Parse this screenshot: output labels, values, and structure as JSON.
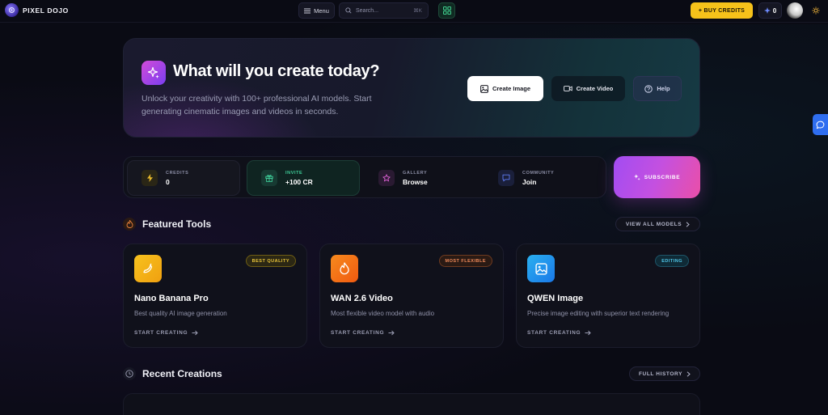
{
  "header": {
    "brand": "PIXEL DOJO",
    "menu_label": "Menu",
    "search_placeholder": "Search...",
    "search_shortcut": "⌘K",
    "buy_credits_label": "+ BUY CREDITS",
    "credit_count": "0"
  },
  "hero": {
    "title": "What will you create today?",
    "subtitle": "Unlock your creativity with 100+ professional AI models. Start generating cinematic images and videos in seconds.",
    "buttons": {
      "create_image": "Create Image",
      "create_video": "Create Video",
      "help": "Help"
    }
  },
  "stats": [
    {
      "label": "CREDITS",
      "value": "0",
      "icon": "lightning-icon"
    },
    {
      "label": "INVITE",
      "value": "+100 CR",
      "icon": "gift-icon"
    },
    {
      "label": "GALLERY",
      "value": "Browse",
      "icon": "star-icon"
    },
    {
      "label": "COMMUNITY",
      "value": "Join",
      "icon": "chat-icon"
    }
  ],
  "subscribe_label": "SUBSCRIBE",
  "featured": {
    "title": "Featured Tools",
    "view_all_label": "VIEW ALL MODELS",
    "cards": [
      {
        "title": "Nano Banana Pro",
        "description": "Best quality AI image generation",
        "badge": "BEST QUALITY",
        "cta": "START CREATING",
        "icon": "banana-icon"
      },
      {
        "title": "WAN 2.6 Video",
        "description": "Most flexible video model with audio",
        "badge": "MOST FLEXIBLE",
        "cta": "START CREATING",
        "icon": "flame-icon"
      },
      {
        "title": "QWEN Image",
        "description": "Precise image editing with superior text rendering",
        "badge": "EDITING",
        "cta": "START CREATING",
        "icon": "image-icon"
      }
    ]
  },
  "recent": {
    "title": "Recent Creations",
    "history_label": "FULL HISTORY"
  },
  "colors": {
    "accent_yellow": "#f6c21a",
    "accent_purple": "#a24cf2",
    "accent_pink": "#ea4fa8",
    "background": "#0a0b14"
  }
}
